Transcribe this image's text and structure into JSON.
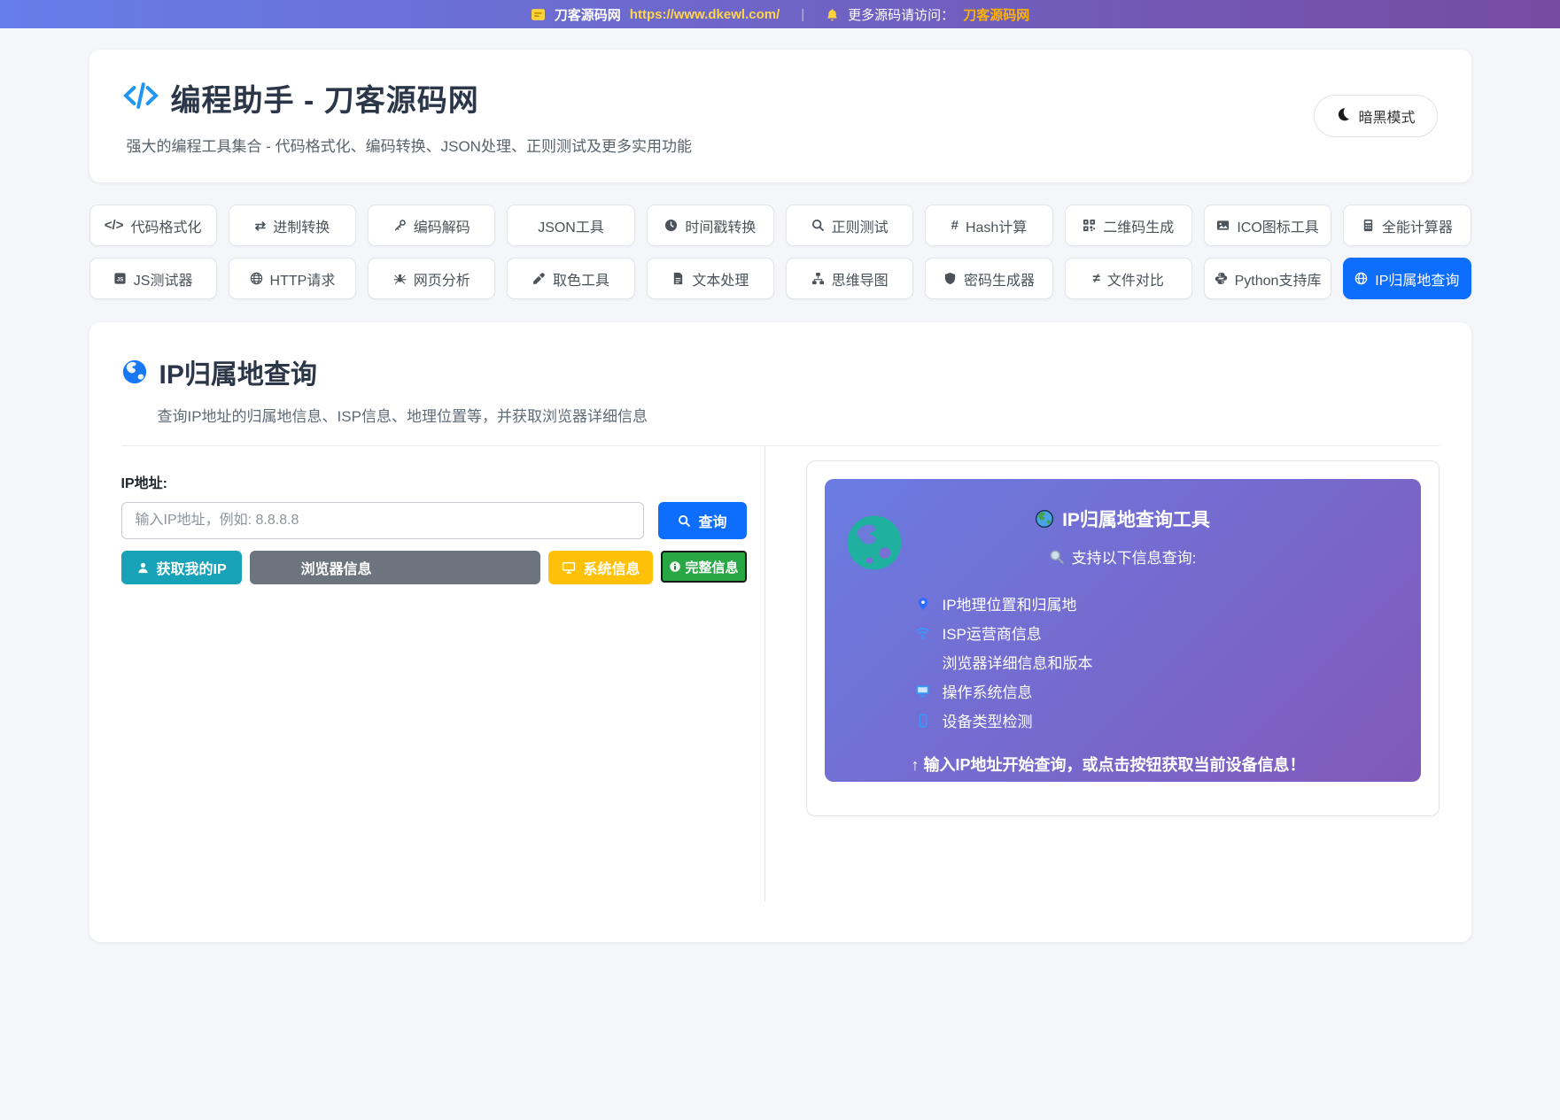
{
  "topbar": {
    "site_icon": "list-icon",
    "site_name": "刀客源码网",
    "site_url": "https://www.dkewl.com/",
    "separator": "|",
    "bell_icon": "bell-icon",
    "more_text": "更多源码请访问：",
    "more_link": "刀客源码网"
  },
  "header": {
    "logo_icon": "code-icon",
    "title": "编程助手 - 刀客源码网",
    "subtitle": "强大的编程工具集合 - 代码格式化、编码转换、JSON处理、正则测试及更多实用功能",
    "dark_mode_icon": "moon-icon",
    "dark_mode_label": "暗黑模式"
  },
  "tools": {
    "active_color": "#0d6efd",
    "items": [
      {
        "label": "代码格式化",
        "icon": "code-icon",
        "active": false
      },
      {
        "label": "进制转换",
        "icon": "swap-arrows-icon",
        "active": false
      },
      {
        "label": "编码解码",
        "icon": "key-icon",
        "active": false
      },
      {
        "label": "JSON工具",
        "icon": "",
        "active": false
      },
      {
        "label": "时间戳转换",
        "icon": "clock-icon",
        "active": false
      },
      {
        "label": "正则测试",
        "icon": "search-icon",
        "active": false
      },
      {
        "label": "Hash计算",
        "icon": "hash-icon",
        "active": false
      },
      {
        "label": "二维码生成",
        "icon": "qrcode-icon",
        "active": false
      },
      {
        "label": "ICO图标工具",
        "icon": "image-icon",
        "active": false
      },
      {
        "label": "全能计算器",
        "icon": "calculator-icon",
        "active": false
      },
      {
        "label": "JS测试器",
        "icon": "js-icon",
        "active": false
      },
      {
        "label": "HTTP请求",
        "icon": "globe-icon",
        "active": false
      },
      {
        "label": "网页分析",
        "icon": "spider-icon",
        "active": false
      },
      {
        "label": "取色工具",
        "icon": "eyedropper-icon",
        "active": false
      },
      {
        "label": "文本处理",
        "icon": "document-icon",
        "active": false
      },
      {
        "label": "思维导图",
        "icon": "sitemap-icon",
        "active": false
      },
      {
        "label": "密码生成器",
        "icon": "shield-icon",
        "active": false
      },
      {
        "label": "文件对比",
        "icon": "not-equal-icon",
        "active": false
      },
      {
        "label": "Python支持库",
        "icon": "python-icon",
        "active": false
      },
      {
        "label": "IP归属地查询",
        "icon": "globe-icon",
        "active": true
      }
    ]
  },
  "main": {
    "section_icon": "globe-icon",
    "section_title": "IP归属地查询",
    "section_subtitle": "查询IP地址的归属地信息、ISP信息、地理位置等，并获取浏览器详细信息",
    "form": {
      "ip_label": "IP地址:",
      "ip_placeholder": "输入IP地址，例如: 8.8.8.8",
      "ip_value": "",
      "query_button": "查询",
      "my_ip_button": "获取我的IP",
      "browser_info_button": "浏览器信息",
      "system_info_button": "系统信息",
      "full_info_button": "完整信息"
    },
    "info_card": {
      "watermark_icon": "globe-watermark-icon",
      "title_icon": "globe-emoji-icon",
      "title": "IP归属地查询工具",
      "subtitle_icon": "magnifier-icon",
      "subtitle": "支持以下信息查询:",
      "features": [
        {
          "icon": "location-pin-icon",
          "text": "IP地理位置和归属地"
        },
        {
          "icon": "wifi-icon",
          "text": "ISP运营商信息"
        },
        {
          "icon": "",
          "text": "浏览器详细信息和版本"
        },
        {
          "icon": "monitor-icon",
          "text": "操作系统信息"
        },
        {
          "icon": "mobile-icon",
          "text": "设备类型检测"
        }
      ],
      "footer_note": "↑ 输入IP地址开始查询，或点击按钮获取当前设备信息！"
    }
  },
  "colors": {
    "topbar_gradient": [
      "#667eea",
      "#764ba2"
    ],
    "accent_blue": "#0d6efd",
    "teal": "#17a2b8",
    "gray": "#6c757d",
    "yellow": "#ffc107",
    "green": "#28a745",
    "card_gradient": [
      "#6a7ce2",
      "#8159ba"
    ],
    "globe_teal": "#1fb0a0"
  }
}
